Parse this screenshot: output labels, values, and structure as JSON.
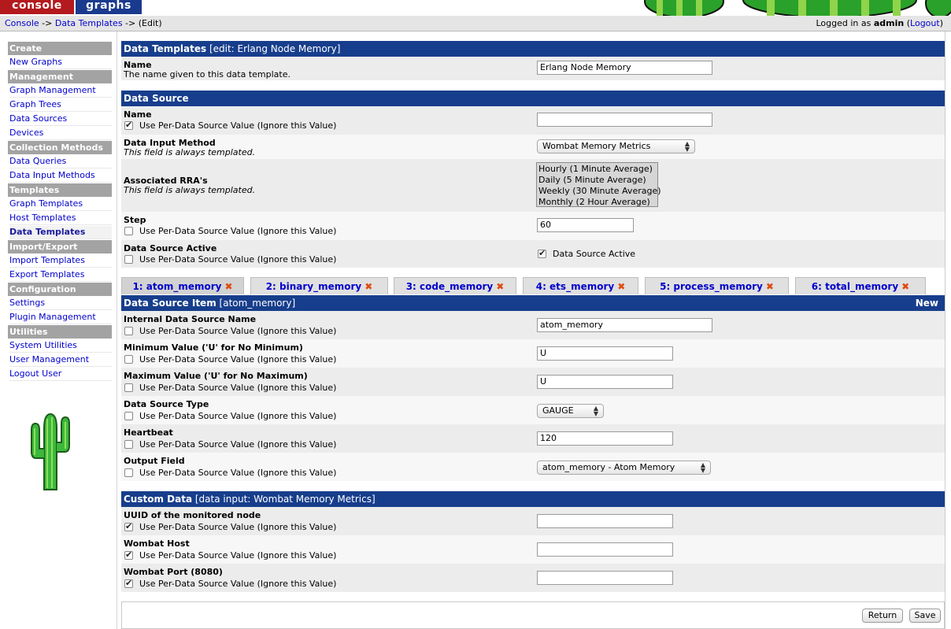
{
  "top_tabs": {
    "console": "console",
    "graphs": "graphs"
  },
  "breadcrumb": {
    "console": "Console",
    "sep1": " -> ",
    "data_templates": "Data Templates",
    "sep2": " -> ",
    "edit": "(Edit)"
  },
  "login": {
    "prefix": "Logged in as ",
    "user": "admin",
    "open": " (",
    "logout": "Logout",
    "close": ")"
  },
  "sidebar": {
    "create": "Create",
    "new_graphs": "New Graphs",
    "management": "Management",
    "graph_management": "Graph Management",
    "graph_trees": "Graph Trees",
    "data_sources": "Data Sources",
    "devices": "Devices",
    "collection_methods": "Collection Methods",
    "data_queries": "Data Queries",
    "data_input_methods": "Data Input Methods",
    "templates": "Templates",
    "graph_templates": "Graph Templates",
    "host_templates": "Host Templates",
    "data_templates": "Data Templates",
    "import_export": "Import/Export",
    "import_templates": "Import Templates",
    "export_templates": "Export Templates",
    "configuration": "Configuration",
    "settings": "Settings",
    "plugin_management": "Plugin Management",
    "utilities": "Utilities",
    "system_utilities": "System Utilities",
    "user_management": "User Management",
    "logout_user": "Logout User"
  },
  "template_section": {
    "title": "Data Templates",
    "subtitle": "[edit: Erlang Node Memory]",
    "name_label": "Name",
    "name_desc": "The name given to this data template.",
    "name_value": "Erlang Node Memory"
  },
  "data_source_section": {
    "title": "Data Source",
    "name_label": "Name",
    "per_ds_text": "Use Per-Data Source Value (Ignore this Value)",
    "name_value": "",
    "input_method_label": "Data Input Method",
    "always_templated": "This field is always templated.",
    "input_method_value": "Wombat Memory Metrics",
    "rra_label": "Associated RRA's",
    "rra_options": [
      "Hourly (1 Minute Average)",
      "Daily (5 Minute Average)",
      "Weekly (30 Minute Average)",
      "Monthly (2 Hour Average)"
    ],
    "step_label": "Step",
    "step_value": "60",
    "active_label": "Data Source Active",
    "active_checkbox_label": "Data Source Active"
  },
  "ds_tabs": [
    {
      "label": "1: atom_memory"
    },
    {
      "label": "2: binary_memory"
    },
    {
      "label": "3: code_memory"
    },
    {
      "label": "4: ets_memory"
    },
    {
      "label": "5: process_memory"
    },
    {
      "label": "6: total_memory"
    }
  ],
  "tab_close_glyph": "✖",
  "ds_item_section": {
    "title": "Data Source Item",
    "subtitle": "[atom_memory]",
    "new_label": "New",
    "internal_name_label": "Internal Data Source Name",
    "internal_name_value": "atom_memory",
    "min_label": "Minimum Value ('U' for No Minimum)",
    "min_value": "U",
    "max_label": "Maximum Value ('U' for No Maximum)",
    "max_value": "U",
    "type_label": "Data Source Type",
    "type_value": "GAUGE",
    "heartbeat_label": "Heartbeat",
    "heartbeat_value": "120",
    "output_label": "Output Field",
    "output_value": "atom_memory - Atom Memory"
  },
  "custom_section": {
    "title": "Custom Data",
    "subtitle": "[data input: Wombat Memory Metrics]",
    "uuid_label": "UUID of the monitored node",
    "host_label": "Wombat Host",
    "port_label": "Wombat Port (8080)"
  },
  "buttons": {
    "return": "Return",
    "save": "Save"
  },
  "colors": {
    "section_header": "#173e8c",
    "console_tab": "#b3191d",
    "graphs_tab": "#1a3a8e",
    "menu_header": "#a3a3a3",
    "tab_close": "#e04a10"
  }
}
